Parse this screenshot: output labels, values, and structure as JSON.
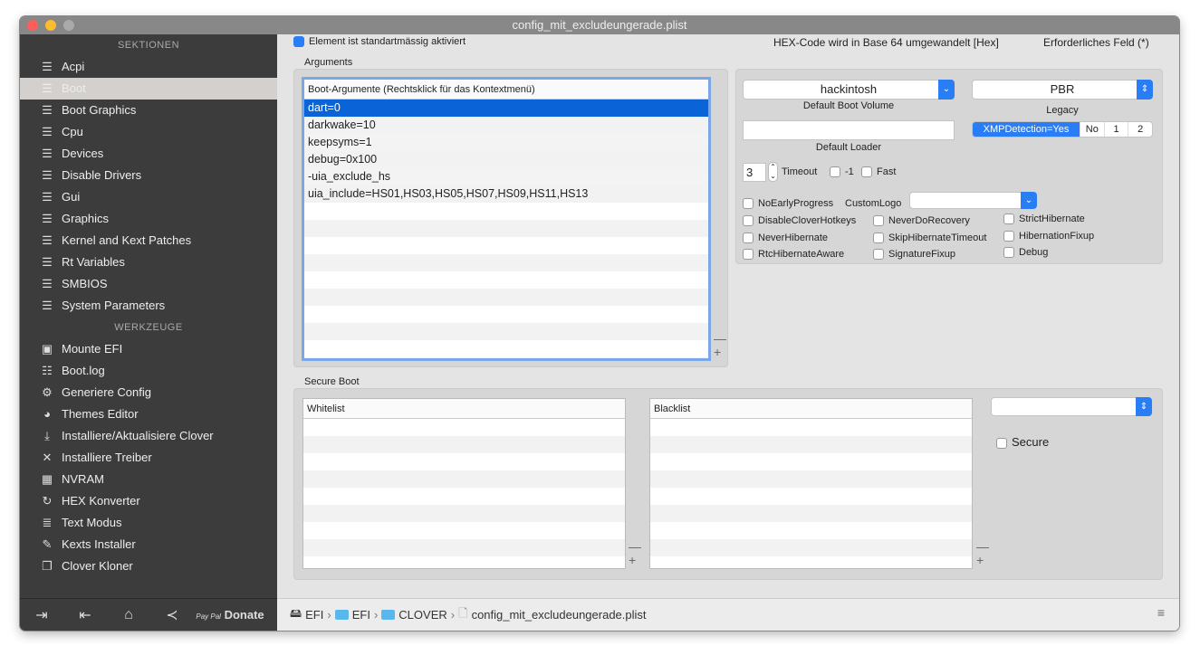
{
  "window": {
    "title": "config_mit_excludeungerade.plist"
  },
  "sidebar": {
    "sections_header": "SEKTIONEN",
    "sections": [
      "Acpi",
      "Boot",
      "Boot Graphics",
      "Cpu",
      "Devices",
      "Disable Drivers",
      "Gui",
      "Graphics",
      "Kernel and Kext Patches",
      "Rt Variables",
      "SMBIOS",
      "System Parameters"
    ],
    "selected": "Boot",
    "tools_header": "WERKZEUGE",
    "tools": [
      {
        "label": "Mounte EFI",
        "icon": "disk-icon"
      },
      {
        "label": "Boot.log",
        "icon": "log-icon"
      },
      {
        "label": "Generiere Config",
        "icon": "gears-icon"
      },
      {
        "label": "Themes Editor",
        "icon": "palette-icon"
      },
      {
        "label": "Installiere/Aktualisiere Clover",
        "icon": "download-icon"
      },
      {
        "label": "Installiere Treiber",
        "icon": "tools-icon"
      },
      {
        "label": "NVRAM",
        "icon": "chip-icon"
      },
      {
        "label": "HEX Konverter",
        "icon": "refresh-icon"
      },
      {
        "label": "Text Modus",
        "icon": "text-icon"
      },
      {
        "label": "Kexts Installer",
        "icon": "plug-icon"
      },
      {
        "label": "Clover Kloner",
        "icon": "copy-icon"
      }
    ],
    "footer": {
      "paypal": "Pay Pal",
      "donate": "Donate"
    }
  },
  "header": {
    "default_enabled": "Element ist standartmässig aktiviert",
    "hex_note": "HEX-Code wird in Base 64 umgewandelt [Hex]",
    "required_note": "Erforderliches Feld (*)"
  },
  "arguments": {
    "title": "Arguments",
    "column": "Boot-Argumente (Rechtsklick für das Kontextmenü)",
    "rows": [
      "dart=0",
      "darkwake=10",
      "keepsyms=1",
      "debug=0x100",
      "-uia_exclude_hs",
      "uia_include=HS01,HS03,HS05,HS07,HS09,HS11,HS13"
    ]
  },
  "settings": {
    "default_boot_volume": {
      "value": "hackintosh",
      "label": "Default Boot Volume"
    },
    "legacy": {
      "value": "PBR",
      "label": "Legacy"
    },
    "default_loader": {
      "value": "",
      "label": "Default Loader"
    },
    "xmp": [
      "XMPDetection=Yes",
      "No",
      "1",
      "2"
    ],
    "timeout": {
      "value": "3",
      "label": "Timeout"
    },
    "minus_one": "-1",
    "fast": "Fast",
    "no_early_progress": "NoEarlyProgress",
    "custom_logo": "CustomLogo",
    "checks": [
      "DisableCloverHotkeys",
      "NeverDoRecovery",
      "StrictHibernate",
      "NeverHibernate",
      "SkipHibernateTimeout",
      "HibernationFixup",
      "RtcHibernateAware",
      "SignatureFixup",
      "Debug"
    ]
  },
  "secure_boot": {
    "title": "Secure Boot",
    "whitelist": "Whitelist",
    "blacklist": "Blacklist",
    "secure": "Secure"
  },
  "breadcrumb": [
    "EFI",
    "EFI",
    "CLOVER",
    "config_mit_excludeungerade.plist"
  ]
}
